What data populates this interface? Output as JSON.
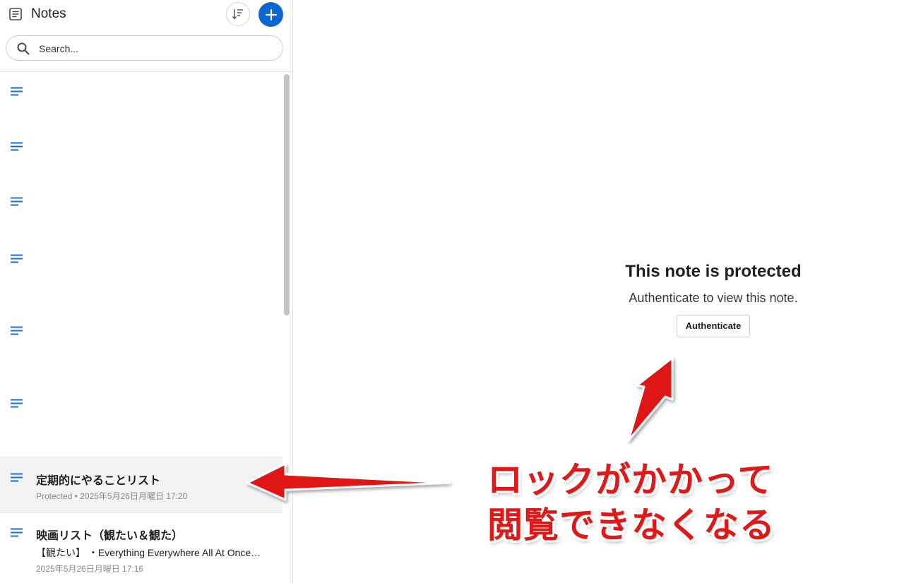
{
  "app": {
    "title": "Notes",
    "icon": "notes-app-icon",
    "accent_color": "#0a66d0"
  },
  "search": {
    "placeholder": "Search..."
  },
  "notes": {
    "selected": {
      "title": "定期的にやることリスト",
      "meta": "Protected • 2025年5月26日月曜日 17:20"
    },
    "other": {
      "title": "映画リスト（観たい＆観た）",
      "preview": "【観たい】 ・Everything Everywhere All At Once…",
      "meta": "2025年5月26日月曜日 17:16"
    }
  },
  "main": {
    "title": "This note is protected",
    "subtitle": "Authenticate to view this note.",
    "button_label": "Authenticate"
  },
  "annotation": {
    "line1": "ロックがかかって",
    "line2": "閲覧できなくなる",
    "color": "#e01818"
  }
}
